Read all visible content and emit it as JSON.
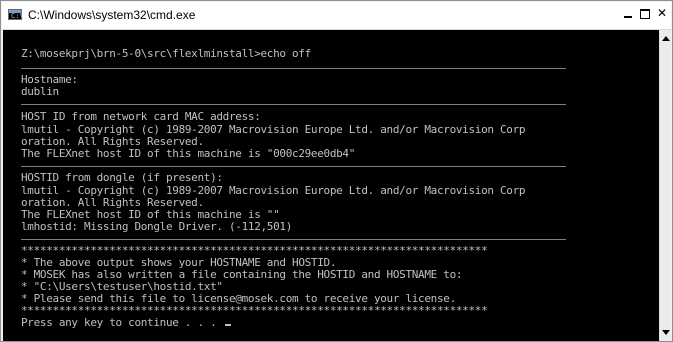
{
  "window": {
    "title": "C:\\Windows\\system32\\cmd.exe",
    "app_icon_glyph": "C:\\",
    "icons": [
      "cmd-app-icon",
      "minimize-icon",
      "maximize-icon",
      "close-icon",
      "scroll-up-arrow-icon",
      "scroll-down-arrow-icon"
    ],
    "colors": {
      "console_background": "#000000",
      "console_text": "#c0c0c0",
      "titlebar_background": "#ffffff"
    }
  },
  "console": {
    "lines": [
      "Z:\\mosekprj\\brn-5-0\\src\\flexlminstall>echo off",
      "Hostname:",
      "dublin",
      "HOST ID from network card MAC address:",
      "lmutil - Copyright (c) 1989-2007 Macrovision Europe Ltd. and/or Macrovision Corp",
      "oration. All Rights Reserved.",
      "The FLEXnet host ID of this machine is \"000c29ee0db4\"",
      "HOSTID from dongle (if present):",
      "lmutil - Copyright (c) 1989-2007 Macrovision Europe Ltd. and/or Macrovision Corp",
      "oration. All Rights Reserved.",
      "The FLEXnet host ID of this machine is \"\"",
      "lmhostid: Missing Dongle Driver. (-112,501)",
      "**************************************************************************",
      "* The above output shows your HOSTNAME and HOSTID.",
      "* MOSEK has also written a file containing the HOSTID and HOSTNAME to:",
      "* \"C:\\Users\\testuser\\hostid.txt\"",
      "* Please send this file to license@mosek.com to receive your license.",
      "**************************************************************************",
      "Press any key to continue . . . "
    ]
  }
}
